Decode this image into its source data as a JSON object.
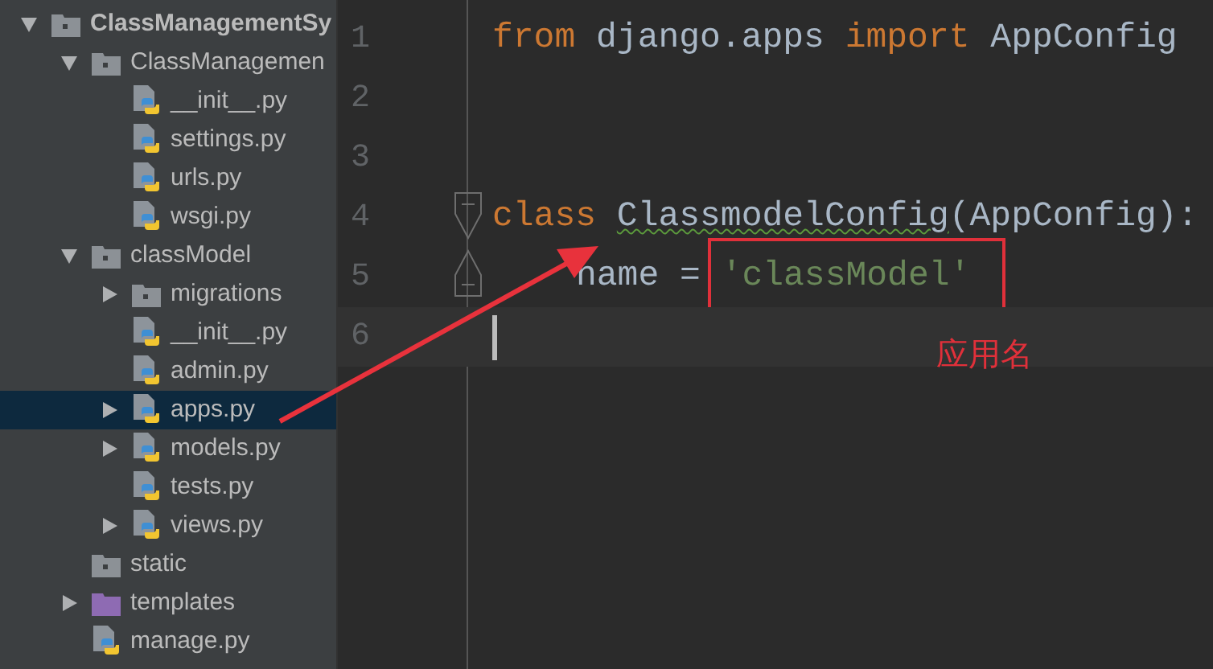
{
  "project_tree": [
    {
      "label": "ClassManagementSy",
      "kind": "project",
      "expanded": true,
      "selected": false,
      "children": [
        {
          "label": "ClassManagemen",
          "kind": "package",
          "expanded": true,
          "selected": false,
          "children": [
            {
              "label": "__init__.py",
              "kind": "python",
              "selected": false
            },
            {
              "label": "settings.py",
              "kind": "python",
              "selected": false
            },
            {
              "label": "urls.py",
              "kind": "python",
              "selected": false
            },
            {
              "label": "wsgi.py",
              "kind": "python",
              "selected": false
            }
          ]
        },
        {
          "label": "classModel",
          "kind": "package",
          "expanded": true,
          "selected": false,
          "children": [
            {
              "label": "migrations",
              "kind": "package",
              "expanded": false,
              "selected": false
            },
            {
              "label": "__init__.py",
              "kind": "python",
              "selected": false
            },
            {
              "label": "admin.py",
              "kind": "python",
              "selected": false
            },
            {
              "label": "apps.py",
              "kind": "python",
              "expanded": false,
              "selected": true
            },
            {
              "label": "models.py",
              "kind": "python",
              "expanded": false,
              "selected": false
            },
            {
              "label": "tests.py",
              "kind": "python",
              "selected": false
            },
            {
              "label": "views.py",
              "kind": "python",
              "expanded": false,
              "selected": false
            }
          ]
        },
        {
          "label": "static",
          "kind": "package",
          "selected": false
        },
        {
          "label": "templates",
          "kind": "templates",
          "expanded": false,
          "selected": false
        },
        {
          "label": "manage.py",
          "kind": "python",
          "selected": false
        }
      ]
    }
  ],
  "editor": {
    "lines": [
      {
        "number": "1",
        "indent": false,
        "fold_start": false,
        "fold_end": false,
        "current": false,
        "tokens": [
          {
            "text": "from",
            "kind": "keyword",
            "boxed": false
          },
          {
            "text": " django.apps ",
            "kind": "plain",
            "boxed": false
          },
          {
            "text": "import",
            "kind": "keyword",
            "boxed": false
          },
          {
            "text": " AppConfig",
            "kind": "plain",
            "boxed": false
          }
        ]
      },
      {
        "number": "2",
        "fold_start": false,
        "fold_end": false,
        "current": false
      },
      {
        "number": "3",
        "fold_start": false,
        "fold_end": false,
        "current": false
      },
      {
        "number": "4",
        "indent": false,
        "fold_start": true,
        "fold_end": false,
        "current": false,
        "tokens": [
          {
            "text": "class ",
            "kind": "keyword",
            "boxed": false
          },
          {
            "text": "ClassmodelConfig",
            "kind": "warning",
            "boxed": false
          },
          {
            "text": "(AppConfig):",
            "kind": "plain",
            "boxed": false
          }
        ]
      },
      {
        "number": "5",
        "indent": true,
        "fold_start": false,
        "fold_end": true,
        "current": false,
        "tokens": [
          {
            "text": "name = ",
            "kind": "plain",
            "boxed": false
          },
          {
            "text": "'classModel'",
            "kind": "string",
            "boxed": true
          }
        ]
      },
      {
        "number": "6",
        "fold_start": false,
        "fold_end": false,
        "current": true
      }
    ]
  },
  "annotation": {
    "label": "应用名"
  }
}
